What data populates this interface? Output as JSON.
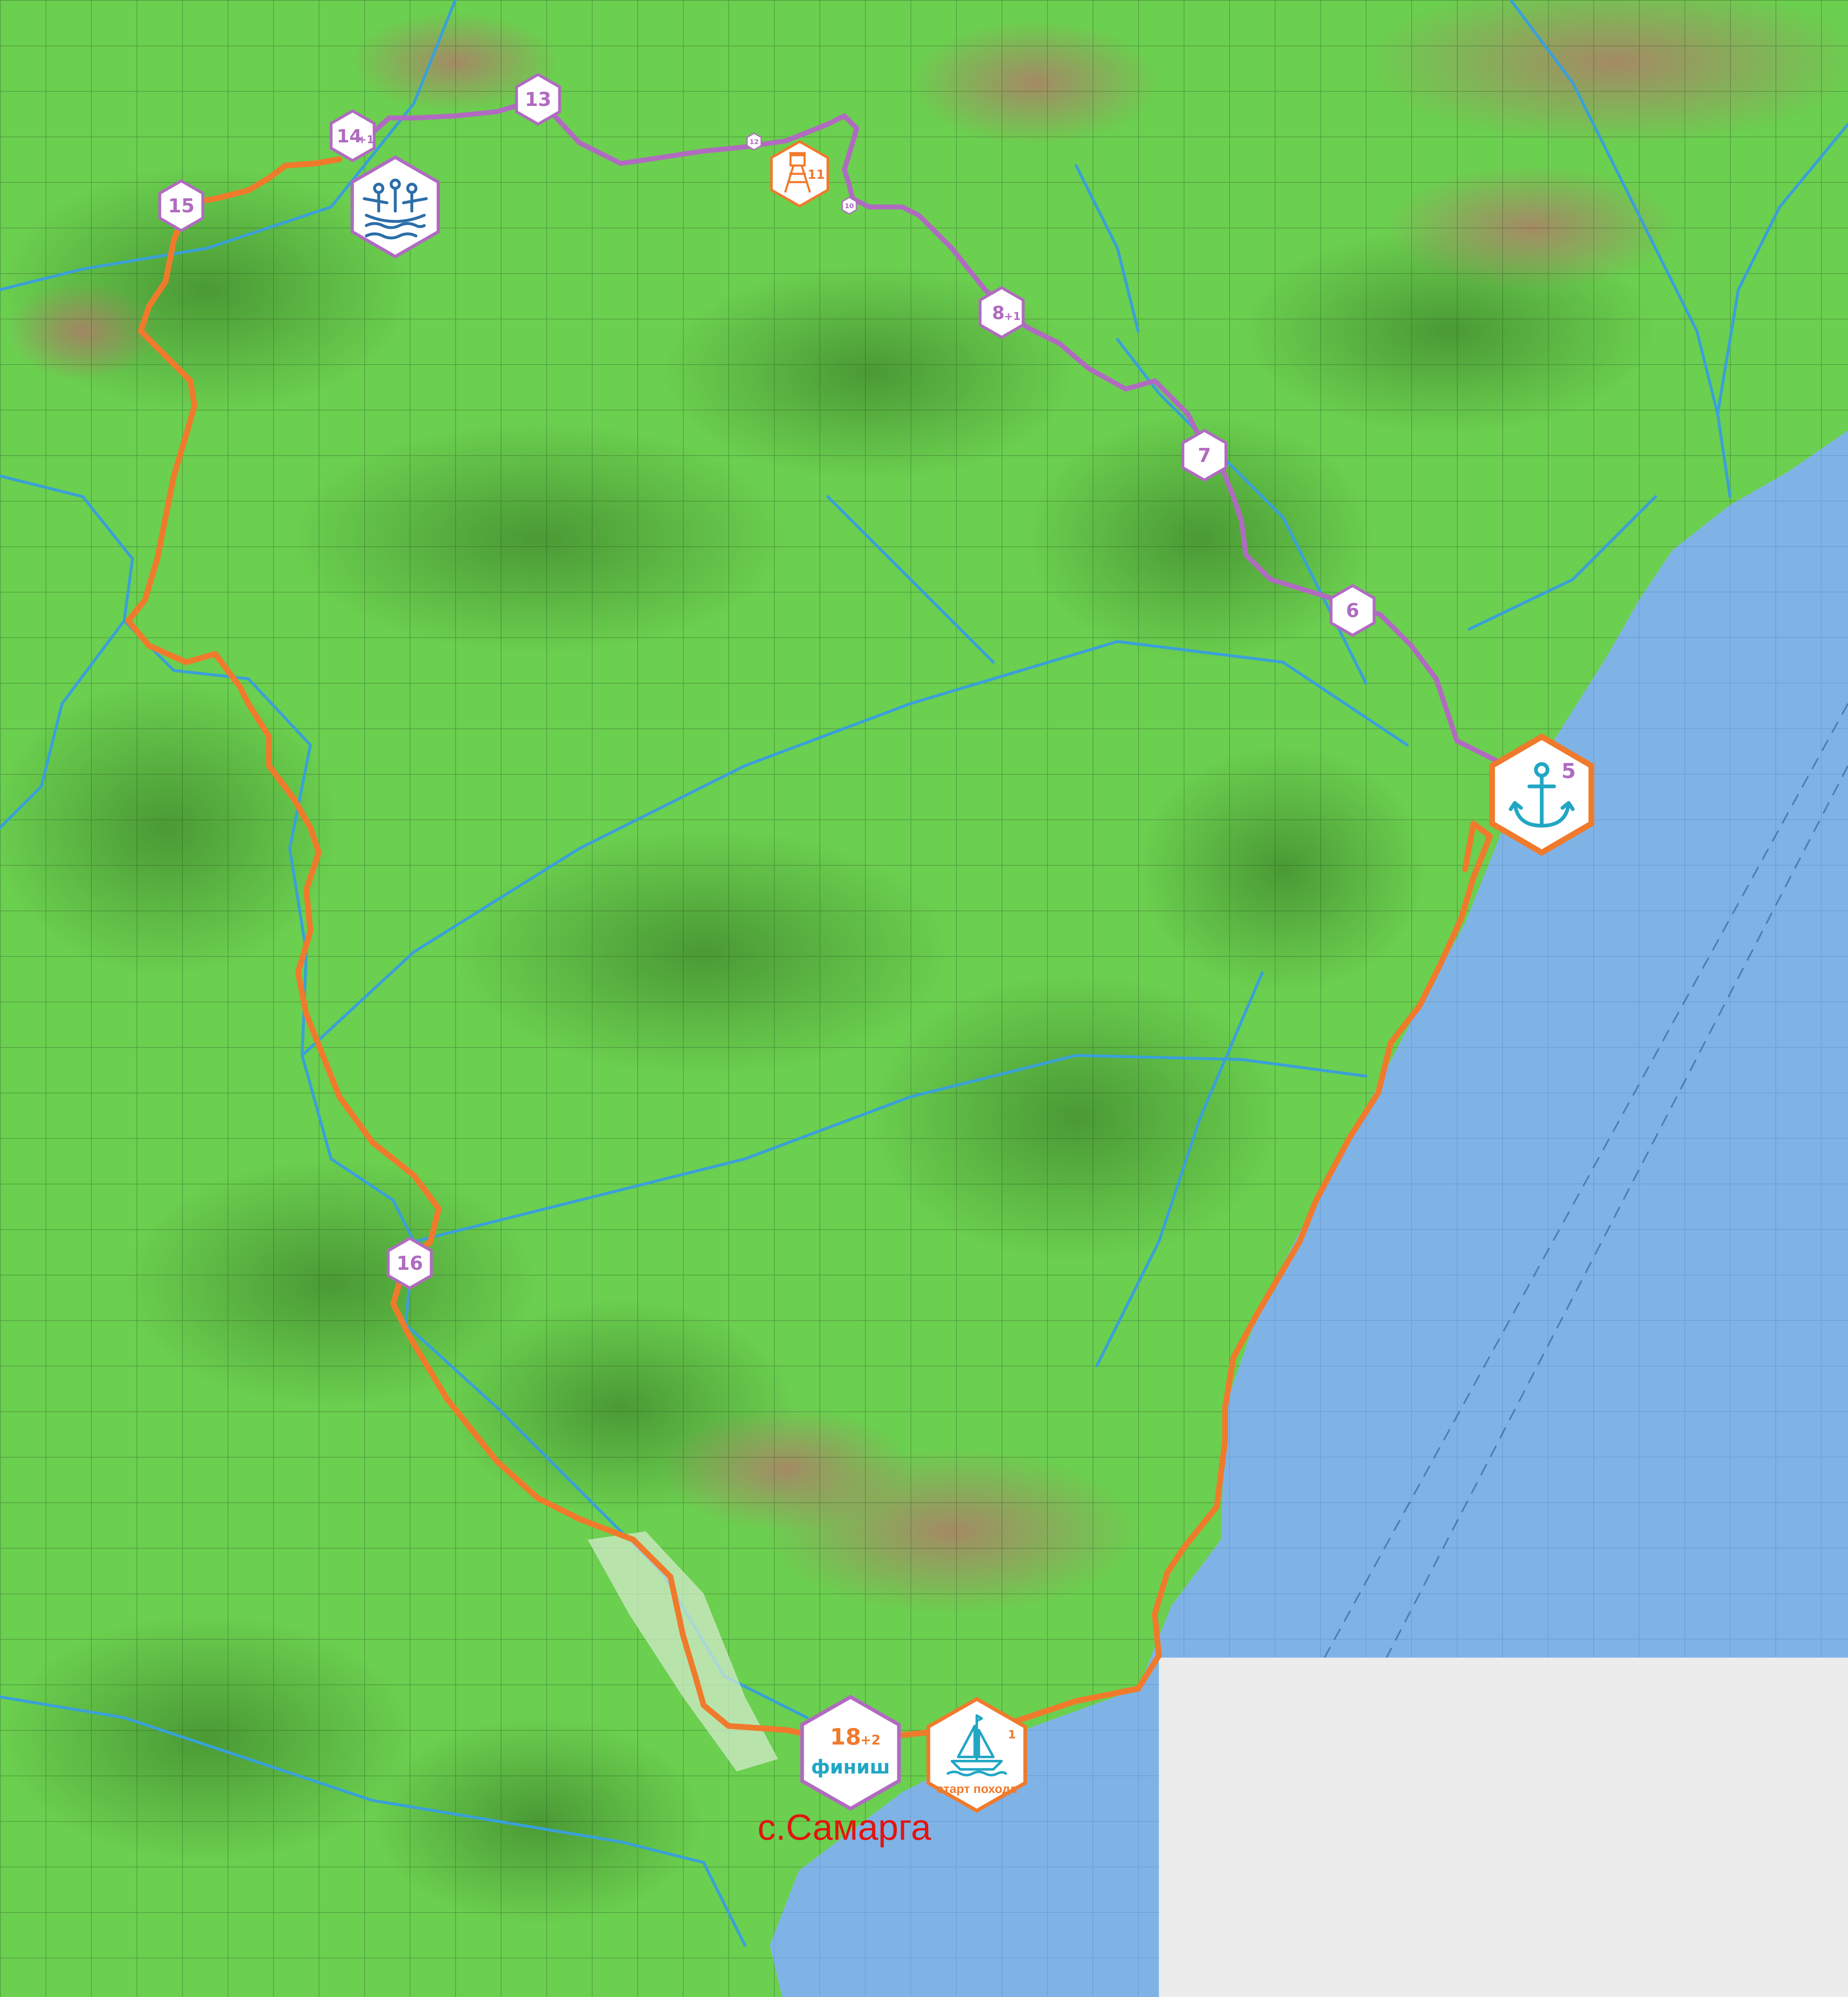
{
  "colors": {
    "land": "#6bcf4f",
    "land_dark": "#3f8f2a",
    "highland": "#c99a86",
    "sea": "#7fb3e6",
    "river": "#3aa0d8",
    "route_orange": "#f07a2c",
    "route_purple": "#b06bc0",
    "finish_teal": "#21a7c4",
    "label_red": "#e3140f",
    "blank": "#ececec"
  },
  "waypoints": [
    {
      "id": "wp-1",
      "number": "1",
      "caption": "старт похода",
      "icon": "sailboat-icon",
      "style": "orange-large"
    },
    {
      "id": "wp-5",
      "number": "5",
      "icon": "anchor-icon",
      "style": "orange-large"
    },
    {
      "id": "wp-6",
      "number": "6",
      "style": "purple"
    },
    {
      "id": "wp-7",
      "number": "7",
      "style": "purple"
    },
    {
      "id": "wp-8",
      "number": "8",
      "extra": "+1",
      "style": "purple"
    },
    {
      "id": "wp-10",
      "number": "10",
      "style": "purple-tiny"
    },
    {
      "id": "wp-11",
      "number": "11",
      "icon": "watchtower-icon",
      "style": "orange-small"
    },
    {
      "id": "wp-12",
      "number": "12",
      "style": "purple-tiny"
    },
    {
      "id": "wp-13",
      "number": "13",
      "style": "purple"
    },
    {
      "id": "wp-14",
      "number": "14",
      "extra": "+1",
      "style": "purple"
    },
    {
      "id": "wp-15",
      "number": "15",
      "style": "purple"
    },
    {
      "id": "wp-16",
      "number": "16",
      "style": "purple"
    },
    {
      "id": "wp-18",
      "number": "18",
      "extra": "+2",
      "caption": "финиш",
      "style": "purple-large"
    }
  ],
  "icons": {
    "rafting": "rafting-icon",
    "anchor": "anchor-icon",
    "sailboat": "sailboat-icon",
    "tower": "watchtower-icon"
  },
  "labels": {
    "village": "с.Самарга"
  }
}
